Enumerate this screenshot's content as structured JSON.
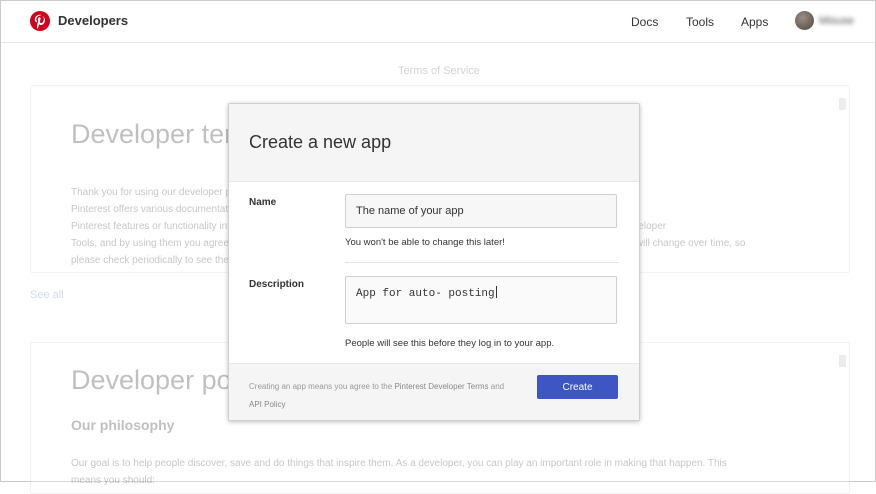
{
  "nav": {
    "brand": "Developers",
    "links": [
      "Docs",
      "Tools",
      "Apps"
    ],
    "user_name": "Misuse"
  },
  "background": {
    "tos_heading": "Terms of Service",
    "card1": {
      "title": "Developer terms",
      "paragraphs": [
        "Thank you for using our developer products and services!",
        "Pinterest offers various documentation, tools and content to assist developers and others who may be integrating",
        "Pinterest features or functionality into their apps, websites, and devices. These terms apply to your access to and use of the Developer",
        "Tools, and by using them you agree to these terms. We may update these terms as our Developer Tools evolve, so these terms will change over time, so",
        "please check periodically to see the latest version."
      ]
    },
    "see_all": "See all",
    "card2": {
      "title": "Developer policy",
      "subtitle": "Our philosophy",
      "paragraphs": [
        "Our goal is to help people discover, save and do things that inspire them. As a developer, you can play an important role in making that happen. This",
        "means you should:"
      ]
    }
  },
  "modal": {
    "title": "Create a new app",
    "name_label": "Name",
    "name_value": "The name of your app",
    "name_hint": "You won't be able to change this later!",
    "description_label": "Description",
    "description_value": "App for auto- posting",
    "description_hint": "People will see this before they log in to your app.",
    "footer_prefix": "Creating an app means you agree to the ",
    "footer_terms_link": "Pinterest Developer Terms",
    "footer_and": " and ",
    "footer_policy_link": "API Policy",
    "create_button": "Create"
  },
  "colors": {
    "brand_red": "#d0021b",
    "create_button": "#3d56c4",
    "link": "#6c8ecf"
  },
  "icons": [
    "pinterest-logo-icon",
    "avatar"
  ]
}
